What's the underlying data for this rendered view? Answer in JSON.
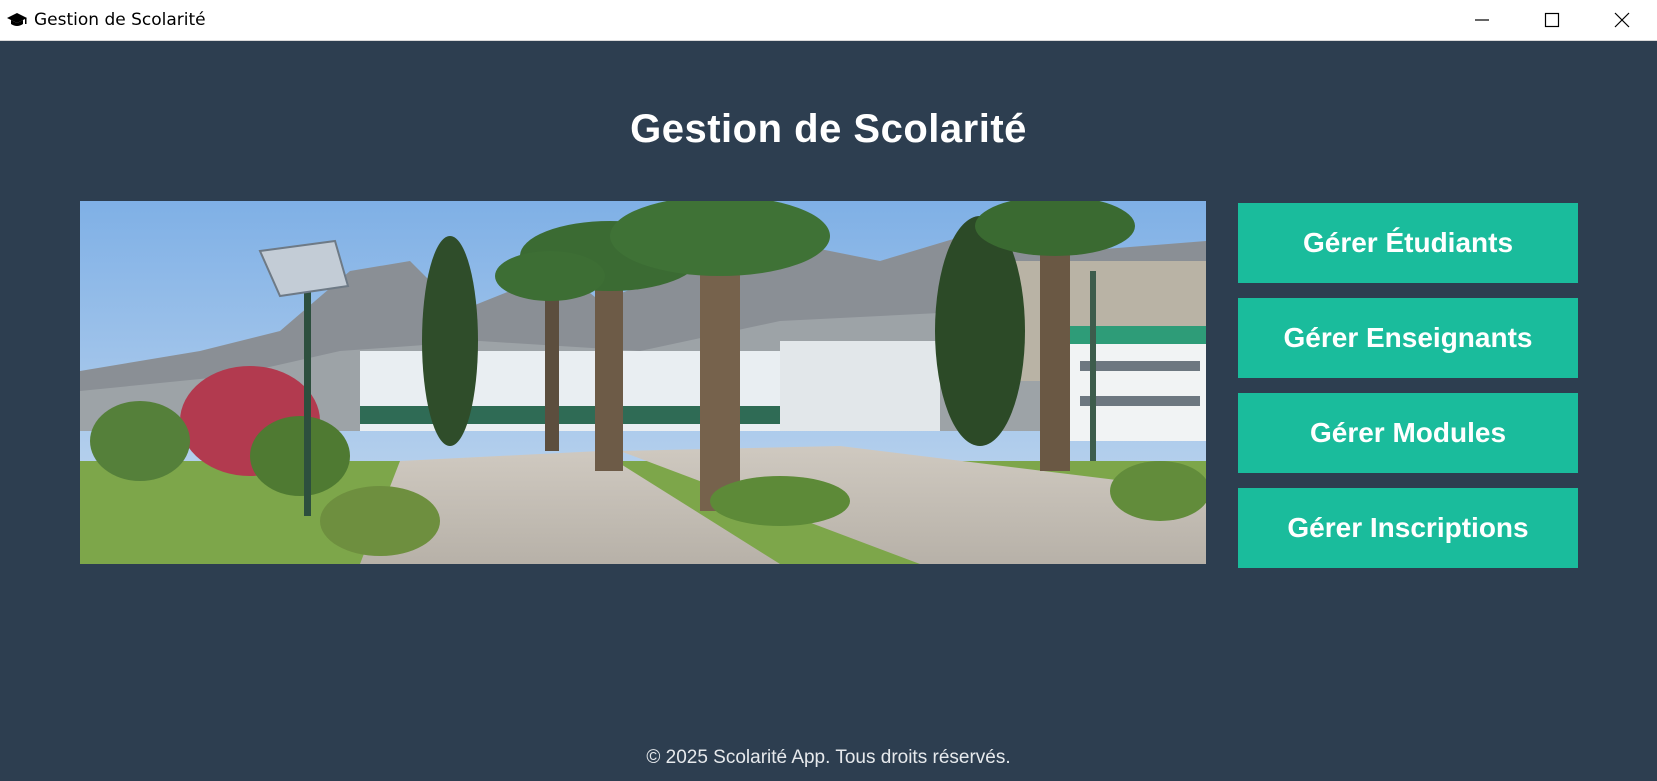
{
  "window": {
    "title": "Gestion de Scolarité",
    "app_icon": "graduation-cap-icon",
    "controls": [
      "minimize-icon",
      "maximize-icon",
      "close-icon"
    ]
  },
  "main": {
    "title": "Gestion de Scolarité",
    "banner_image": "campus-photo",
    "buttons": [
      {
        "label": "Gérer Étudiants"
      },
      {
        "label": "Gérer Enseignants"
      },
      {
        "label": "Gérer Modules"
      },
      {
        "label": "Gérer Inscriptions"
      }
    ]
  },
  "footer": {
    "text": "© 2025 Scolarité App. Tous droits réservés."
  },
  "colors": {
    "background": "#2d3e50",
    "button": "#1abc9c",
    "text": "#ffffff"
  }
}
